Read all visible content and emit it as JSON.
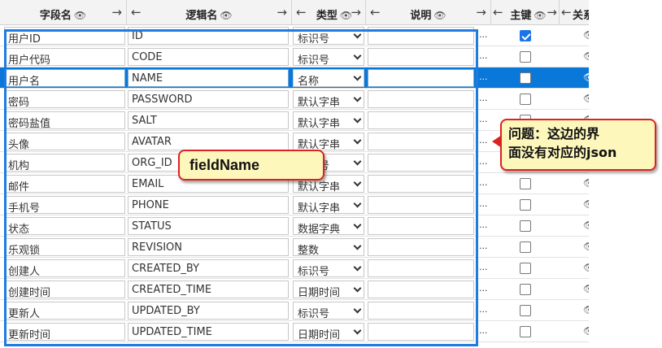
{
  "header": {
    "field_name": "字段名",
    "logic_name": "逻辑名",
    "type": "类型",
    "desc": "说明",
    "primary_key": "主键",
    "relation": "关系",
    "arrow_left": "←",
    "arrow_right": "→",
    "eye": "👁"
  },
  "rows": [
    {
      "field": "用户ID",
      "logic": "ID",
      "type": "标识号",
      "pk": true
    },
    {
      "field": "用户代码",
      "logic": "CODE",
      "type": "标识号",
      "pk": false
    },
    {
      "field": "用户名",
      "logic": "NAME",
      "type": "名称",
      "pk": false,
      "selected": true
    },
    {
      "field": "密码",
      "logic": "PASSWORD",
      "type": "默认字串",
      "pk": false
    },
    {
      "field": "密码盐值",
      "logic": "SALT",
      "type": "默认字串",
      "pk": false
    },
    {
      "field": "头像",
      "logic": "AVATAR",
      "type": "默认字串",
      "pk": false
    },
    {
      "field": "机构",
      "logic": "ORG_ID",
      "type": "标识号",
      "pk": false
    },
    {
      "field": "邮件",
      "logic": "EMAIL",
      "type": "默认字串",
      "pk": false
    },
    {
      "field": "手机号",
      "logic": "PHONE",
      "type": "默认字串",
      "pk": false
    },
    {
      "field": "状态",
      "logic": "STATUS",
      "type": "数据字典",
      "pk": false
    },
    {
      "field": "乐观锁",
      "logic": "REVISION",
      "type": "整数",
      "pk": false
    },
    {
      "field": "创建人",
      "logic": "CREATED_BY",
      "type": "标识号",
      "pk": false
    },
    {
      "field": "创建时间",
      "logic": "CREATED_TIME",
      "type": "日期时间",
      "pk": false
    },
    {
      "field": "更新人",
      "logic": "UPDATED_BY",
      "type": "标识号",
      "pk": false
    },
    {
      "field": "更新时间",
      "logic": "UPDATED_TIME",
      "type": "日期时间",
      "pk": false
    }
  ],
  "row_more": "...",
  "annotations": {
    "field_name_label": "fieldName",
    "question_line1": "问题：这边的界",
    "question_line2": "面没有对应的json"
  },
  "colors": {
    "selected_row": "#0a78d8",
    "frame_blue": "#1e7be0",
    "callout_bg": "#fdf7bc",
    "callout_border": "#dd2222"
  }
}
